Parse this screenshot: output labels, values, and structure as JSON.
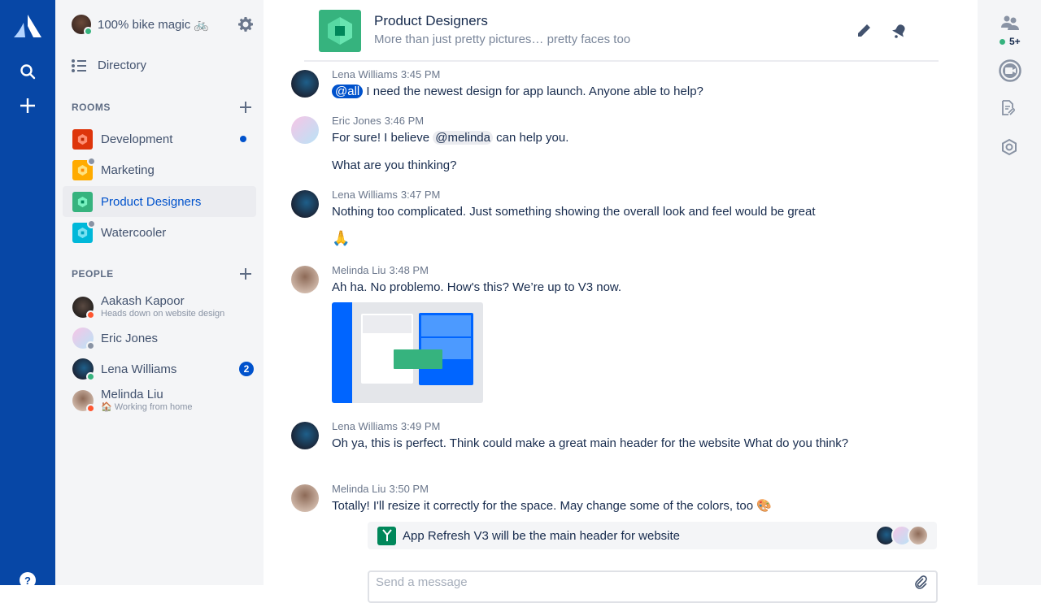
{
  "app": {
    "brand": "Atlassian Stride",
    "accent": "#0052CC",
    "nav_bg": "#0747A6"
  },
  "global_nav": {
    "icons": [
      "atlassian-logo",
      "search-icon",
      "create-icon",
      "help-icon"
    ]
  },
  "sidebar": {
    "user": {
      "status_text": "100% bike magic 🚲",
      "presence": "online"
    },
    "directory_label": "Directory",
    "rooms_header": "ROOMS",
    "rooms": [
      {
        "name": "Development",
        "color": "#DE350B",
        "unread": true,
        "private": false
      },
      {
        "name": "Marketing",
        "color": "#FFAB00",
        "unread": false,
        "private": true
      },
      {
        "name": "Product Designers",
        "color": "#36B37E",
        "unread": false,
        "private": false,
        "selected": true
      },
      {
        "name": "Watercooler",
        "color": "#00B8D9",
        "unread": false,
        "private": true
      }
    ],
    "people_header": "PEOPLE",
    "people": [
      {
        "name": "Aakash Kapoor",
        "status": "Heads down on website design",
        "presence": "busy"
      },
      {
        "name": "Eric Jones",
        "status": "",
        "presence": "offline"
      },
      {
        "name": "Lena Williams",
        "status": "",
        "presence": "online",
        "badge": "2"
      },
      {
        "name": "Melinda Liu",
        "status": "🏠 Working from home",
        "presence": "busy"
      }
    ]
  },
  "header": {
    "title": "Product Designers",
    "subtitle": "More than just pretty pictures… pretty faces too"
  },
  "messages": [
    {
      "author": "Lena Williams",
      "time": "3:45 PM",
      "mention": "@all",
      "text": "I need the newest design for app launch. Anyone able to help?"
    },
    {
      "author": "Eric Jones",
      "time": "3:46 PM",
      "text_before": "For sure! I believe ",
      "mention": "@melinda",
      "text_after": " can help you.",
      "text2": "What are you thinking?"
    },
    {
      "author": "Lena Williams",
      "time": "3:47 PM",
      "text": "Nothing too complicated. Just something showing the overall look and feel would be great",
      "emoji": "🙏"
    },
    {
      "author": "Melinda Liu",
      "time": "3:48 PM",
      "text": "Ah ha. No problemo. How's this? We’re up to V3 now.",
      "attachment": "design-preview-image"
    },
    {
      "author": "Lena Williams",
      "time": "3:49 PM",
      "text": "Oh ya, this is perfect. Think could make a great main header for the website What do you think?"
    },
    {
      "author": "Melinda Liu",
      "time": "3:50 PM",
      "text": "Totally! I'll resize it correctly for the space. May change some of the colors, too 🎨"
    }
  ],
  "decision": {
    "text": "App Refresh V3 will be the main header for website"
  },
  "composer": {
    "placeholder": "Send a message"
  },
  "right_rail": {
    "participants_count": "5+"
  }
}
